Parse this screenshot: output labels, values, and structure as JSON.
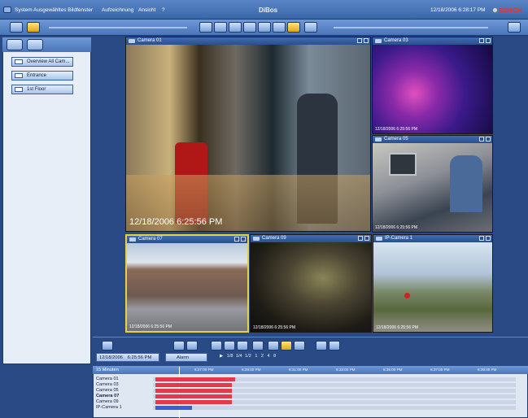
{
  "app": {
    "title": "DiBos",
    "brand": "BOSCH",
    "datetime": "12/18/2006 6:28:17 PM"
  },
  "menu": [
    "System",
    "Ausgewähltes Bildfenster",
    "Aufzeichnung",
    "Ansicht",
    "?"
  ],
  "icons": {
    "system": "app-icon",
    "bosch": "bosch-logo-icon",
    "camera": "camera-icon"
  },
  "views": [
    "Overview All Cam...",
    "Entrance",
    "1st Floor"
  ],
  "cameras": [
    {
      "name": "Camera 01",
      "timestamp": "12/18/2006 6:25:56 PM"
    },
    {
      "name": "Camera 03",
      "timestamp": "12/18/2006 6:25:56 PM"
    },
    {
      "name": "Camera 05",
      "timestamp": "12/18/2006 6:25:56 PM"
    },
    {
      "name": "Camera 07",
      "timestamp": "12/18/2006 6:25:56 PM"
    },
    {
      "name": "Camera 09",
      "timestamp": "12/18/2006 6:25:56 PM"
    },
    {
      "name": "IP-Camera 1",
      "timestamp": "12/18/2006 6:25:56 PM"
    }
  ],
  "playback": {
    "date": "12/18/2006",
    "time": "6:25:56 PM",
    "alarm_label": "Alarm",
    "speeds": [
      "1/8",
      "1/4",
      "1/2",
      "1",
      "2",
      "4",
      "8"
    ]
  },
  "timeline": {
    "range_label": "15 Minuten",
    "ticks": [
      "6:27:00 PM",
      "6:29:00 PM",
      "6:31:00 PM",
      "6:33:00 PM",
      "6:35:00 PM",
      "6:37:00 PM",
      "6:39:00 PM"
    ],
    "rows": [
      {
        "label": "Camera 01",
        "bold": false,
        "color": "#e23a4a",
        "fill": 0.22
      },
      {
        "label": "Camera 03",
        "bold": false,
        "color": "#e23a4a",
        "fill": 0.21
      },
      {
        "label": "Camera 05",
        "bold": false,
        "color": "#e23a4a",
        "fill": 0.21
      },
      {
        "label": "Camera 07",
        "bold": true,
        "color": "#e23a4a",
        "fill": 0.21
      },
      {
        "label": "Camera 09",
        "bold": false,
        "color": "#e23a4a",
        "fill": 0.21
      },
      {
        "label": "IP-Camera 1",
        "bold": false,
        "color": "#3a5fd0",
        "fill": 0.1
      }
    ]
  }
}
